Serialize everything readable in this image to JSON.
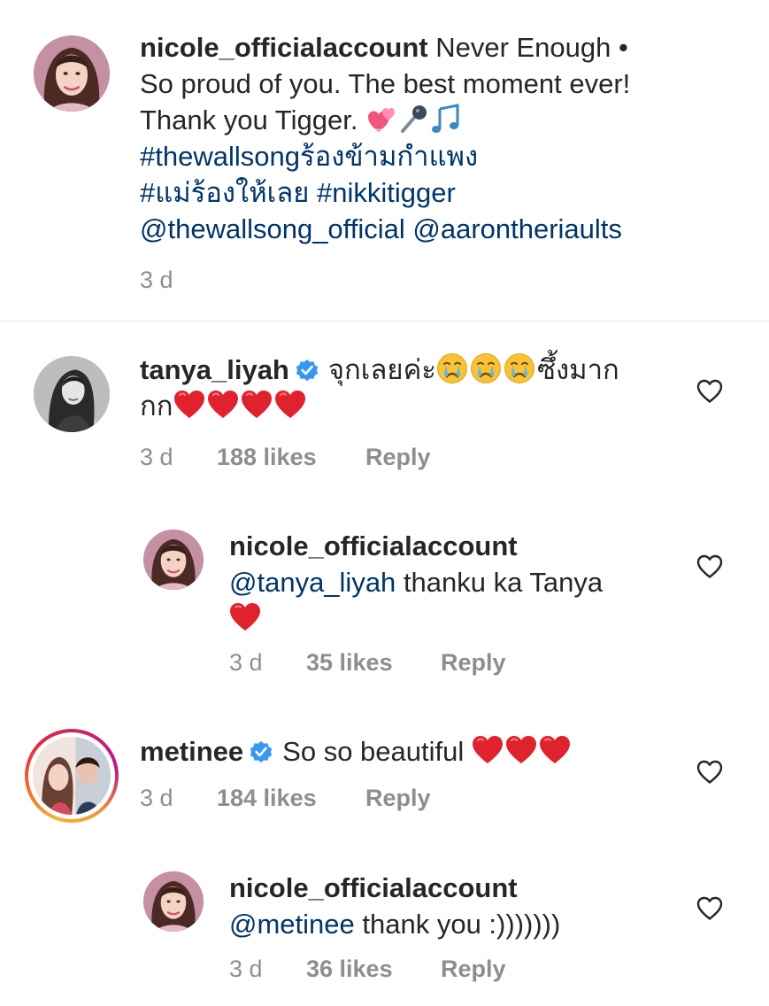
{
  "caption": {
    "username": "nicole_officialaccount",
    "line1": "Never Enough •",
    "line2": "So proud of you. The best moment ever!",
    "line3": "Thank you Tigger.",
    "hashtag1": "#thewallsongร้องข้ามกำแพง",
    "hashtag2": "#แม่ร้องให้เลย",
    "hashtag3": "#nikkitigger",
    "mention1": "@thewallsong_official",
    "mention2": "@aarontheriaults",
    "time": "3 d",
    "emoji_icons": [
      "revolving-hearts-icon",
      "microphone-icon",
      "music-notes-icon"
    ]
  },
  "comments": [
    {
      "username": "tanya_liyah",
      "verified": true,
      "text_start": "จุกเลยค่ะ",
      "text_end": "ซึ้งมาก",
      "text_line2": "กก",
      "time": "3 d",
      "likes": "188 likes",
      "reply": "Reply"
    },
    {
      "username": "nicole_officialaccount",
      "mention": "@tanya_liyah",
      "text": "thanku ka Tanya",
      "time": "3 d",
      "likes": "35 likes",
      "reply": "Reply"
    },
    {
      "username": "metinee",
      "verified": true,
      "text": "So so beautiful",
      "time": "3 d",
      "likes": "184 likes",
      "reply": "Reply"
    },
    {
      "username": "nicole_officialaccount",
      "mention": "@metinee",
      "text": "thank you :)))))))",
      "time": "3 d",
      "likes": "36 likes",
      "reply": "Reply"
    }
  ],
  "colors": {
    "text": "#262626",
    "link": "#003569",
    "meta": "#8e8e8e",
    "verified": "#3897f0",
    "heart": "#e0212e"
  }
}
